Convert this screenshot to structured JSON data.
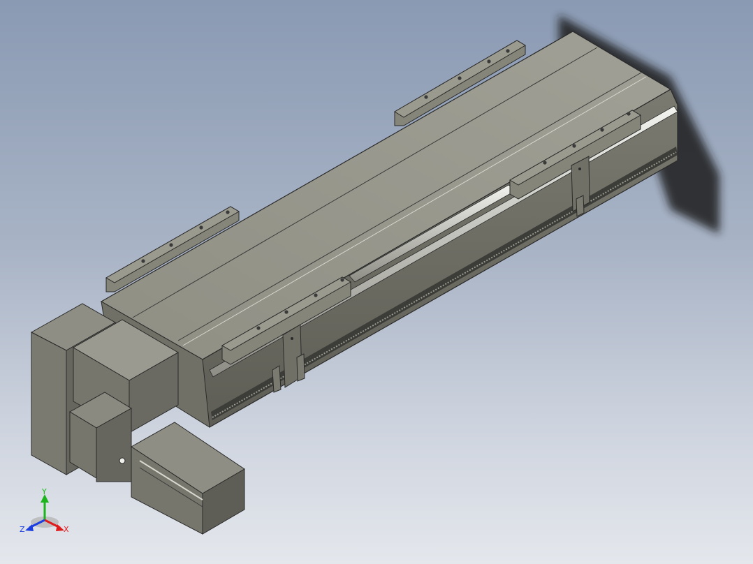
{
  "viewport": {
    "background_top": "#8a9ab3",
    "background_bottom": "#e4e7ec"
  },
  "model": {
    "body_color": "#8c8c80",
    "edge_color": "#2a2a2a",
    "shadow_color": "#222222"
  },
  "triad": {
    "x_label": "X",
    "y_label": "Y",
    "z_label": "Z",
    "x_color": "#e01b1b",
    "y_color": "#1bb51b",
    "z_color": "#1b3ee0"
  }
}
